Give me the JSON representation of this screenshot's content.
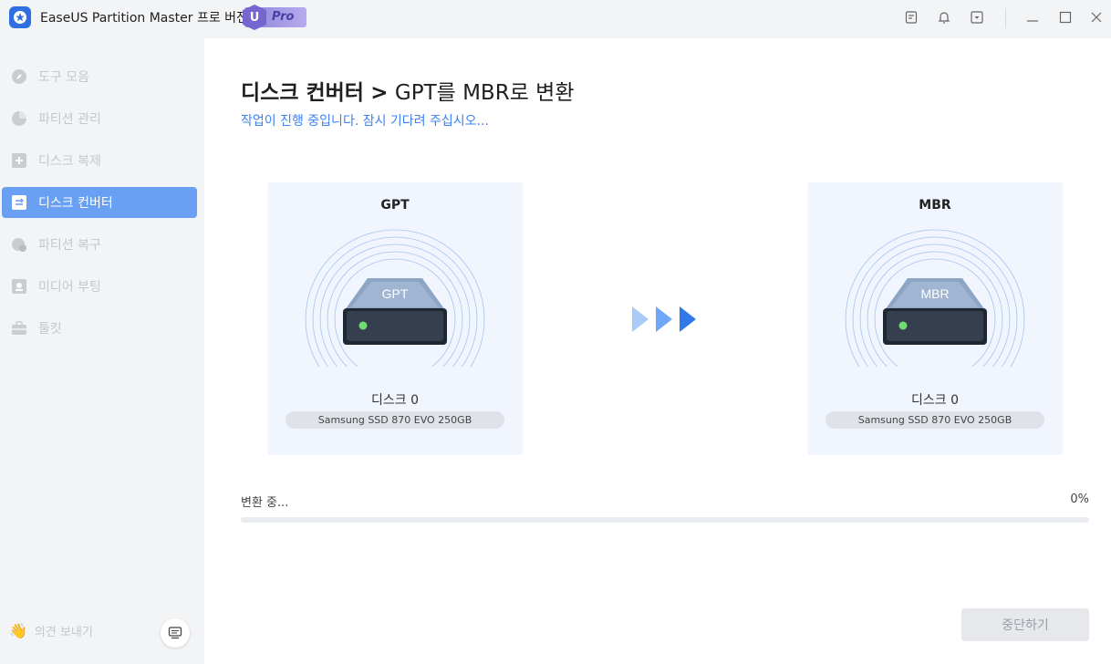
{
  "window": {
    "app_title": "EaseUS Partition Master 프로 버전",
    "edition_badge_letter": "U",
    "edition_badge_text": "Pro"
  },
  "sidebar": {
    "items": [
      {
        "label": "도구 모음",
        "icon": "compass-icon",
        "active": false
      },
      {
        "label": "파티션 관리",
        "icon": "pie-chart-icon",
        "active": false
      },
      {
        "label": "디스크 복제",
        "icon": "clone-icon",
        "active": false
      },
      {
        "label": "디스크 컨버터",
        "icon": "converter-icon",
        "active": true
      },
      {
        "label": "파티션 복구",
        "icon": "recovery-icon",
        "active": false
      },
      {
        "label": "미디어 부팅",
        "icon": "boot-media-icon",
        "active": false
      },
      {
        "label": "툴킷",
        "icon": "toolbox-icon",
        "active": false
      }
    ],
    "feedback_label": "의견 보내기"
  },
  "main": {
    "title_bold": "디스크 컨버터",
    "title_sep": ">",
    "title_rest": "GPT를 MBR로 변환",
    "subtitle": "작업이 진행 중입니다. 잠시 기다려 주십시오...",
    "source": {
      "type": "GPT",
      "disk_label": "디스크 0",
      "model": "Samsung SSD 870 EVO 250GB"
    },
    "target": {
      "type": "MBR",
      "disk_label": "디스크 0",
      "model": "Samsung SSD 870 EVO 250GB"
    },
    "progress": {
      "label": "변환 중...",
      "percent_text": "0%",
      "value": 0
    },
    "stop_button": "중단하기"
  },
  "colors": {
    "accent": "#3b82f6",
    "active_nav": "#6aa0f4",
    "card_bg": "#f0f5fe"
  }
}
